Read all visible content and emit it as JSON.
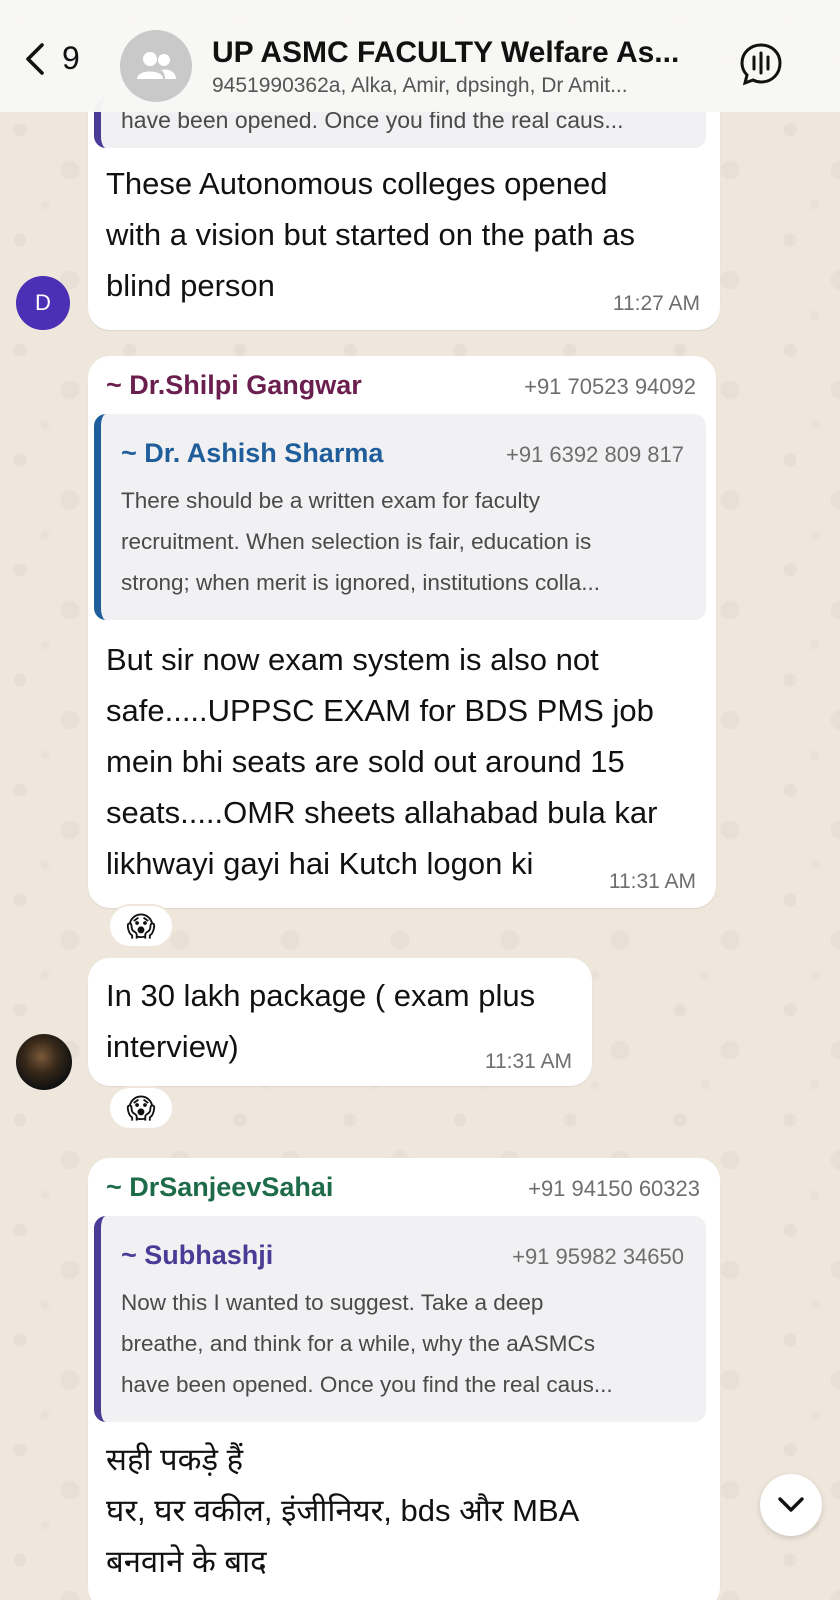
{
  "header": {
    "back_count": "9",
    "title": "UP ASMC FACULTY  Welfare As...",
    "subtitle": "9451990362a, Alka, Amir, dpsingh, Dr Amit..."
  },
  "messages": {
    "m1": {
      "cut_quote": "have been opened. Once you find the real caus...",
      "text_lines": [
        "These Autonomous colleges opened",
        "with a vision but started on the path as",
        "blind person"
      ],
      "time": "11:27 AM",
      "avatar_letter": "D"
    },
    "m2": {
      "sender": "~ Dr.Shilpi Gangwar",
      "phone": "+91 70523 94092",
      "quote_name": "~ Dr. Ashish Sharma",
      "quote_phone": "+91 6392 809 817",
      "quote_lines": [
        "There should be a written exam for faculty",
        "recruitment. When selection is fair, education is",
        "strong; when merit is ignored, institutions colla..."
      ],
      "text_lines": [
        "But sir now exam system is also not",
        "safe.....UPPSC EXAM  for BDS PMS job",
        "mein bhi seats are sold out around 15",
        "seats.....OMR sheets allahabad bula kar",
        "likhwayi gayi hai Kutch logon ki"
      ],
      "time": "11:31 AM",
      "reaction": "😱"
    },
    "m3": {
      "text_lines": [
        "In 30 lakh package ( exam plus",
        "interview)"
      ],
      "time": "11:31 AM",
      "reaction": "😱"
    },
    "m4": {
      "sender": "~ DrSanjeevSahai",
      "phone": "+91 94150 60323",
      "quote_name": "~ Subhashji",
      "quote_phone": "+91 95982 34650",
      "quote_lines": [
        "Now this I wanted to suggest. Take a deep",
        "breathe, and think for a while, why the aASMCs",
        "have been opened. Once you find the real caus..."
      ],
      "text_lines": [
        "सही पकड़े हैं",
        "घर, घर वकील, इंजीनियर, bds और MBA",
        "बनवाने के बाद"
      ]
    }
  },
  "colors": {
    "shilpi": "#6b1f4f",
    "ashish": "#1f5e9b",
    "sanjeev": "#1e6b4a",
    "subhashji": "#4a3c96",
    "quote_bar_blue": "#1f5e9b",
    "quote_bar_purple": "#4a3c96",
    "avatar_d": "#4b2fb5"
  },
  "icons": [
    "chevron-left-icon",
    "group-icon",
    "voice-call-icon",
    "chevron-down-icon"
  ]
}
